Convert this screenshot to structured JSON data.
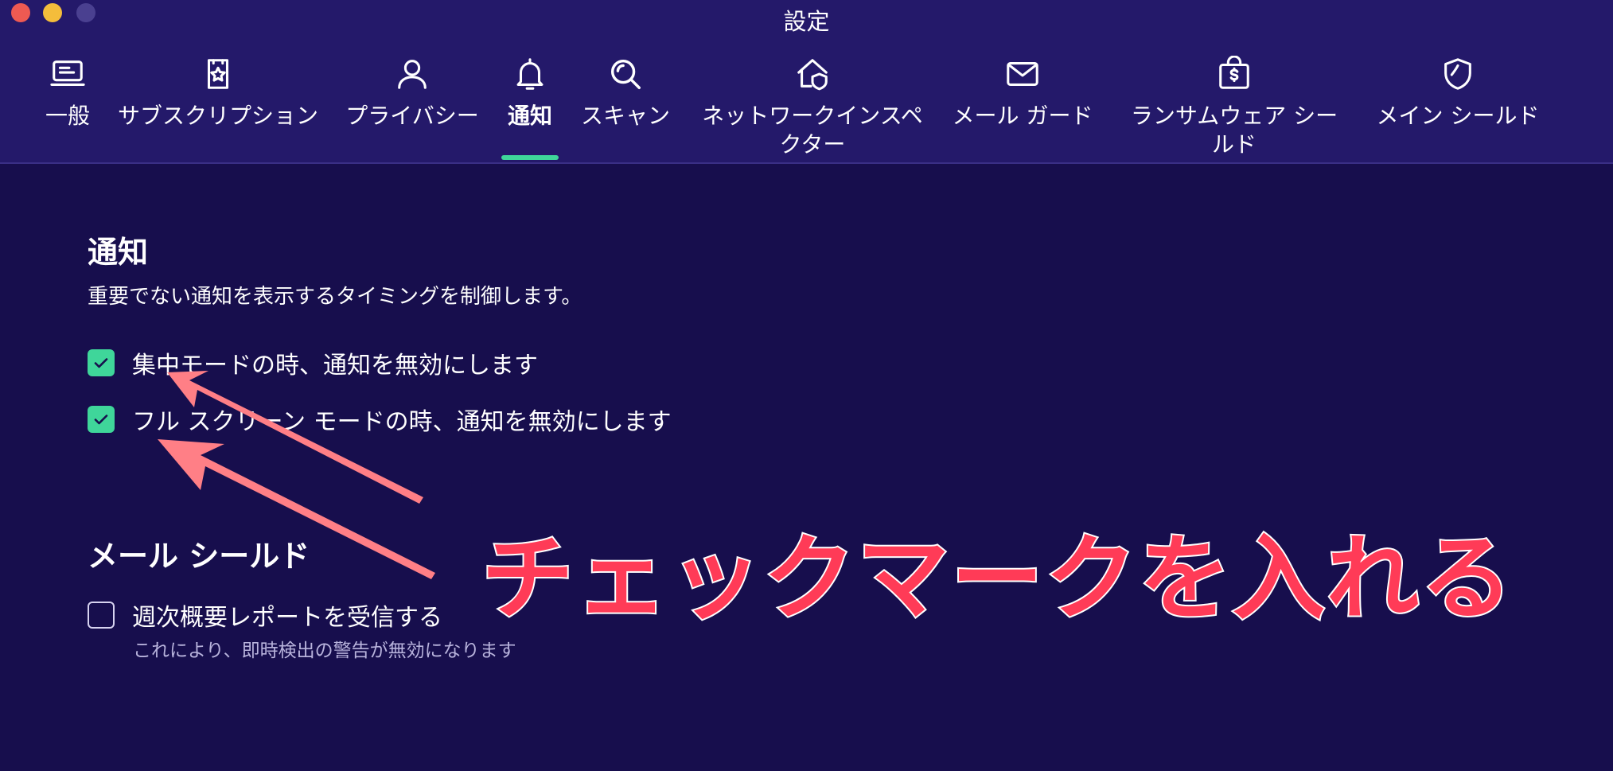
{
  "window": {
    "title": "設定"
  },
  "tabs": [
    {
      "label": "一般",
      "icon": "laptop-icon"
    },
    {
      "label": "サブスクリプション",
      "icon": "subscription-star-icon"
    },
    {
      "label": "プライバシー",
      "icon": "user-icon"
    },
    {
      "label": "通知",
      "icon": "bell-icon",
      "active": true
    },
    {
      "label": "スキャン",
      "icon": "search-icon"
    },
    {
      "label": "ネットワークインスペクター",
      "icon": "home-shield-icon"
    },
    {
      "label": "メール ガード",
      "icon": "mail-icon"
    },
    {
      "label": "ランサムウェア シールド",
      "icon": "money-lock-icon"
    },
    {
      "label": "メイン シールド",
      "icon": "shield-icon"
    }
  ],
  "notifications": {
    "title": "通知",
    "description": "重要でない通知を表示するタイミングを制御します。",
    "options": [
      {
        "label": "集中モードの時、通知を無効にします",
        "checked": true
      },
      {
        "label": "フル スクリーン モードの時、通知を無効にします",
        "checked": true
      }
    ]
  },
  "mail_shield": {
    "title": "メール シールド",
    "option": {
      "label": "週次概要レポートを受信する",
      "checked": false,
      "sublabel": "これにより、即時検出の警告が無効になります"
    }
  },
  "annotation": {
    "text": "チェックマークを入れる"
  },
  "colors": {
    "background": "#170e4d",
    "titlebar": "#24196a",
    "accent_green": "#3fd69a",
    "annotation_red": "#ff3b57",
    "arrow_pink": "#ff7f86"
  }
}
